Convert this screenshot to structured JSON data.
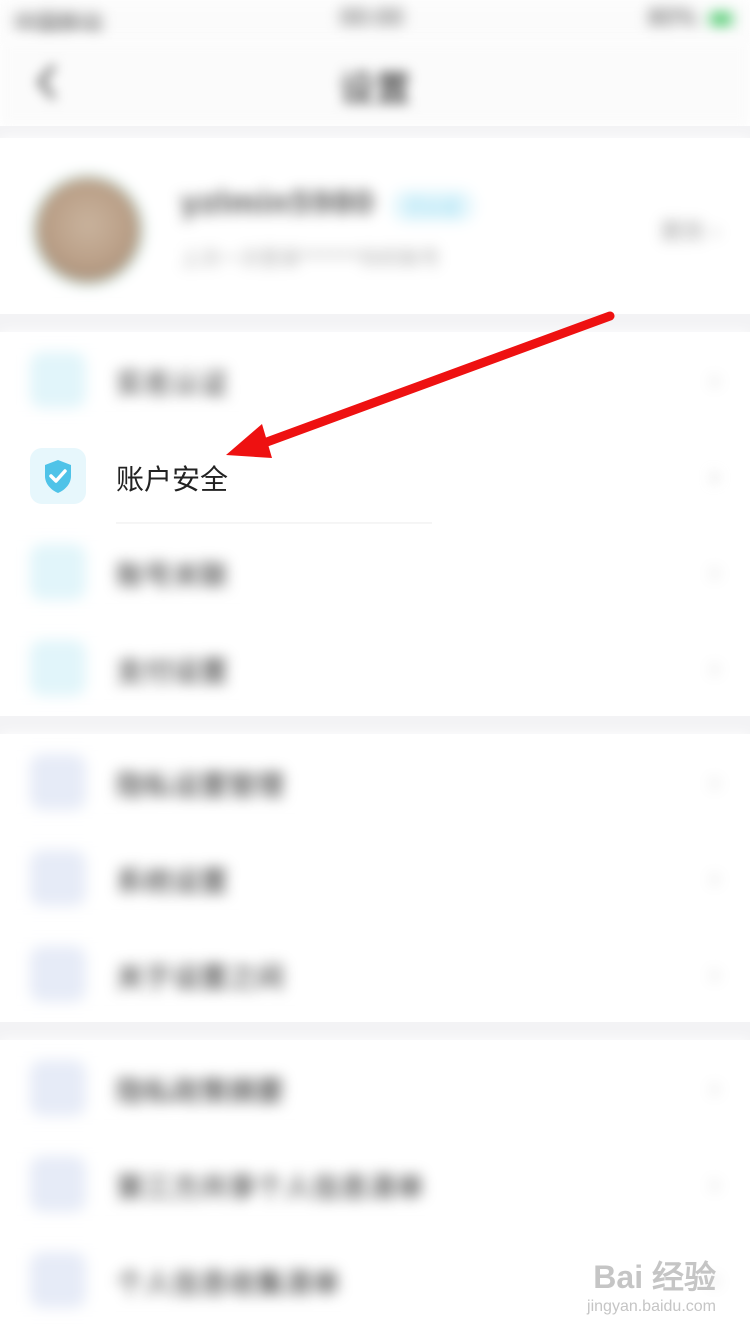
{
  "status": {
    "carrier": "中国移动",
    "time": "00:00",
    "battery": "80%"
  },
  "nav": {
    "title": "设置"
  },
  "profile": {
    "username": "yzlmin5980",
    "badge": "已认证",
    "subtitle": "上次一次登录******你的账号",
    "edit_label": "更改"
  },
  "groups": [
    [
      {
        "label": "实名认证",
        "icon": "person-icon"
      },
      {
        "label": "账户安全",
        "icon": "shield-check-icon"
      },
      {
        "label": "账号关联",
        "icon": "phone-icon"
      },
      {
        "label": "支付设置",
        "icon": "wallet-icon"
      }
    ],
    [
      {
        "label": "隐私设置管理",
        "icon": "doc-icon"
      },
      {
        "label": "系统设置",
        "icon": "doc-icon"
      },
      {
        "label": "关于设置之间",
        "icon": "doc-icon"
      }
    ],
    [
      {
        "label": "隐私政策摘要",
        "icon": "doc-icon"
      },
      {
        "label": "第三方共享个人信息清单",
        "icon": "doc-icon"
      },
      {
        "label": "个人信息收集清单",
        "icon": "doc-icon"
      }
    ]
  ],
  "chevron": "›",
  "annotation": {
    "color": "#ee1111"
  },
  "watermark": {
    "main": "Bai 经验",
    "sub": "jingyan.baidu.com"
  },
  "colors": {
    "shield": "#4fc3e8",
    "background_gap": "#f3f3f5"
  }
}
